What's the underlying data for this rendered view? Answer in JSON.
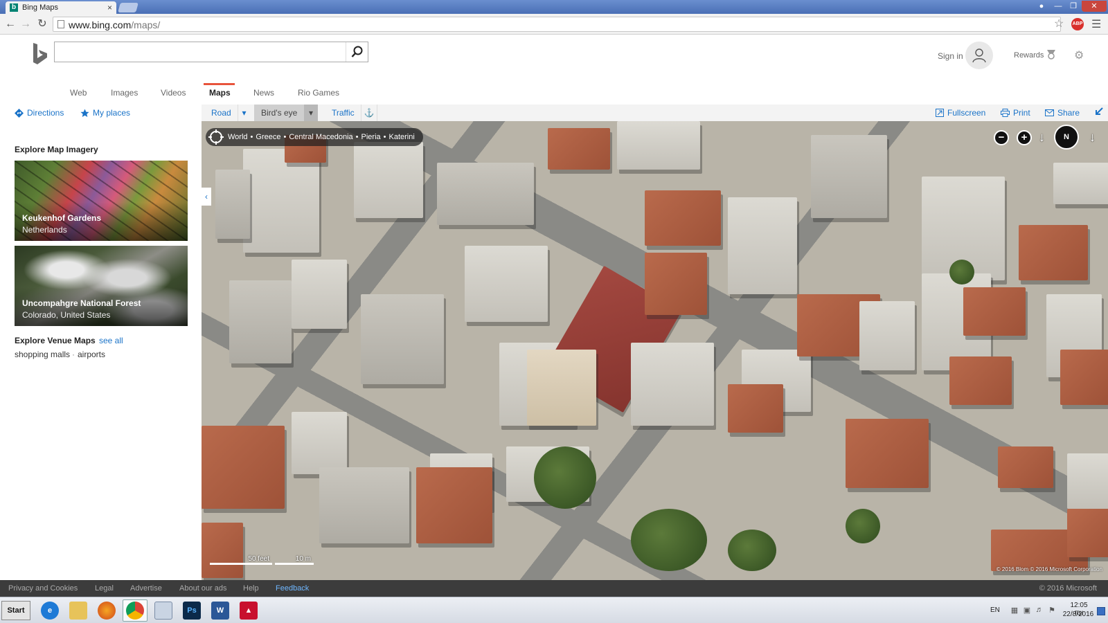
{
  "browser": {
    "tab_title": "Bing Maps",
    "url_host": "www.bing.com",
    "url_path": "/maps/",
    "abp_label": "ABP"
  },
  "bing": {
    "search_placeholder": "",
    "signin_label": "Sign in",
    "rewards_label": "Rewards"
  },
  "scopes": [
    "Web",
    "Images",
    "Videos",
    "Maps",
    "News",
    "Rio Games"
  ],
  "active_scope": "Maps",
  "left_toolbar": {
    "directions": "Directions",
    "my_places": "My places"
  },
  "map_toolbar": {
    "road": "Road",
    "birds_eye": "Bird's eye",
    "traffic": "Traffic",
    "fullscreen": "Fullscreen",
    "print": "Print",
    "share": "Share"
  },
  "sidebar": {
    "explore_heading": "Explore Map Imagery",
    "cards": [
      {
        "title": "Keukenhof Gardens",
        "subtitle": "Netherlands"
      },
      {
        "title": "Uncompahgre National Forest",
        "subtitle": "Colorado, United States"
      }
    ],
    "venue_heading": "Explore Venue Maps",
    "see_all": "see all",
    "venue_items": [
      "shopping malls",
      "airports"
    ],
    "venue_separator": "·"
  },
  "map": {
    "breadcrumb": [
      "World",
      "Greece",
      "Central Macedonia",
      "Pieria",
      "Katerini"
    ],
    "breadcrumb_separator": "•",
    "compass_label": "N",
    "scale_feet": "50 feet",
    "scale_m": "10 m",
    "copyright": "© 2016 Blom  © 2016 Microsoft Corporation"
  },
  "footer": {
    "links": [
      "Privacy and Cookies",
      "Legal",
      "Advertise",
      "About our ads",
      "Help",
      "Feedback"
    ],
    "copyright": "© 2016 Microsoft"
  },
  "taskbar": {
    "start_label": "Start",
    "apps": [
      "internet-explorer",
      "file-explorer",
      "firefox",
      "chrome",
      "calculator",
      "photoshop",
      "word",
      "acrobat"
    ],
    "lang": "EN",
    "time": "12:05 πμ",
    "date": "22/8/2016"
  },
  "colors": {
    "accent_link": "#1a73c8",
    "scope_underline": "#e8543c",
    "bing_logo": "#008373"
  }
}
